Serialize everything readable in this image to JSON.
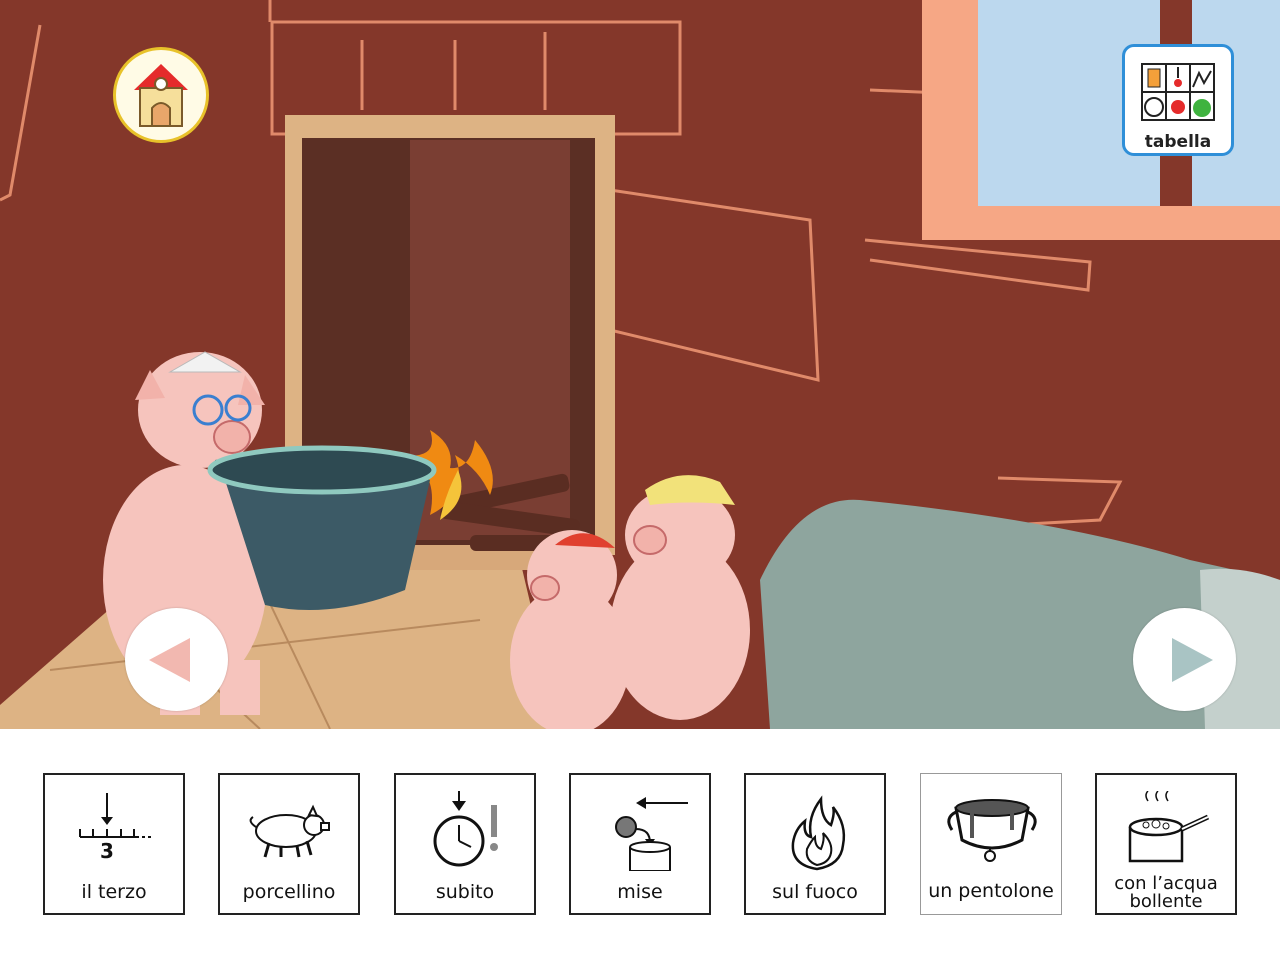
{
  "toolbar": {
    "home_icon": "house-icon",
    "tabella_label": "tabella",
    "tabella_icon": "symbol-grid-icon"
  },
  "navigation": {
    "prev_icon": "triangle-left-icon",
    "next_icon": "triangle-right-icon"
  },
  "scene": {
    "description_icon": "three-pigs-fireplace-illustration"
  },
  "sentence_cards": [
    {
      "label": "il terzo",
      "icon": "third-ordinal-icon"
    },
    {
      "label": "porcellino",
      "icon": "pig-icon"
    },
    {
      "label": "subito",
      "icon": "stopwatch-icon"
    },
    {
      "label": "mise",
      "icon": "put-into-icon"
    },
    {
      "label": "sul fuoco",
      "icon": "fire-icon"
    },
    {
      "label": "un pentolone",
      "icon": "cauldron-icon"
    },
    {
      "label": "con l’acqua bollente",
      "icon": "boiling-pot-icon"
    }
  ],
  "colors": {
    "wall": "#84372a",
    "floor": "#ddb384",
    "fireplace_frame": "#ddb384",
    "pot": "#3c5a66",
    "tabella_border": "#2f8fd8",
    "home_border": "#e8c22a"
  }
}
